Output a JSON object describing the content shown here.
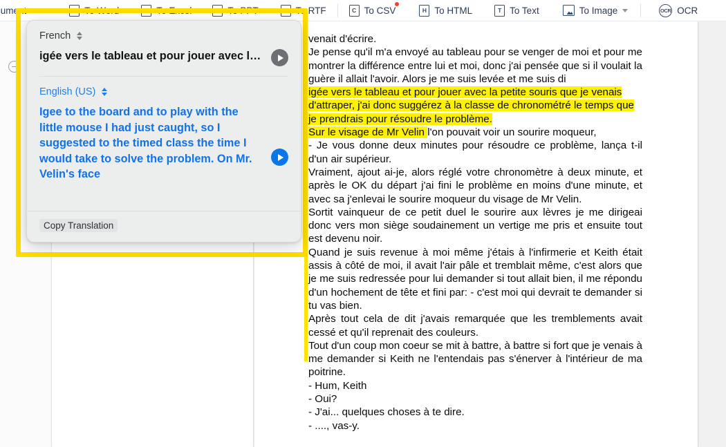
{
  "toolbar": {
    "items": [
      {
        "name": "document-dropdown",
        "label": "cument",
        "icon": "none",
        "caret": true,
        "badge": false
      },
      {
        "name": "to-word",
        "label": "To Word",
        "icon": "W",
        "caret": false,
        "badge": false
      },
      {
        "name": "to-excel",
        "label": "To Excel",
        "icon": "X",
        "caret": false,
        "badge": false
      },
      {
        "name": "to-ppt",
        "label": "To PPT",
        "icon": "P",
        "caret": false,
        "badge": false
      },
      {
        "name": "to-rtf",
        "label": "To RTF",
        "icon": "R",
        "caret": false,
        "badge": false
      },
      {
        "name": "to-csv",
        "label": "To CSV",
        "icon": "C",
        "caret": false,
        "badge": true
      },
      {
        "name": "to-html",
        "label": "To HTML",
        "icon": "H",
        "caret": false,
        "badge": false
      },
      {
        "name": "to-text",
        "label": "To Text",
        "icon": "T",
        "caret": false,
        "badge": false
      },
      {
        "name": "to-image",
        "label": "To Image",
        "icon": "image",
        "caret": true,
        "badge": false
      },
      {
        "name": "ocr",
        "label": "OCR",
        "icon": "ocr",
        "caret": false,
        "badge": false
      }
    ]
  },
  "translate_popup": {
    "source_language": "French",
    "source_text": "igée vers le tableau et pour jouer avec la...",
    "target_language": "English (US)",
    "target_text": "Igee to the board and to play with the little mouse I had just caught, so I suggested to the timed class the time I would take to solve the problem. On Mr. Velin's face",
    "copy_label": "Copy Translation",
    "source_play_icon": "play-icon",
    "target_play_icon": "play-icon",
    "language_stepper_icon": "chevron-updown-icon",
    "accent_color": "#1272ea",
    "panel_color": "#eceded"
  },
  "selection": {
    "highlight_color": "#ffdd00",
    "text_highlight_color": "#fff200"
  },
  "document": {
    "paragraphs": [
      {
        "id": "p1",
        "justify": false,
        "runs": [
          {
            "text": "venait d'écrire.",
            "hl": false
          }
        ]
      },
      {
        "id": "p2",
        "justify": true,
        "runs": [
          {
            "text": "Je pense qu'il m'a envoyé au tableau pour se venger de moi et pour me montrer la différence entre lui et moi, donc j'ai pensée que si il voulait la guère il allait l'avoir. Alors je me suis levée et me suis di",
            "hl": false
          }
        ]
      },
      {
        "id": "p3",
        "justify": false,
        "runs": [
          {
            "text": "   igée vers le tableau et pour jouer avec la petite souris que je venais d'attraper, j'ai donc suggérez à la classe de chronométré le temps que je prendrais pour résoudre le problème.",
            "hl": true
          }
        ]
      },
      {
        "id": "p4",
        "justify": false,
        "runs": [
          {
            "text": "Sur le visage de Mr Velin ",
            "hl": true
          },
          {
            "text": " l'on pouvait voir un sourire moqueur,",
            "hl": false
          }
        ]
      },
      {
        "id": "p5",
        "justify": true,
        "runs": [
          {
            "text": "- Je vous donne deux minutes pour résoudre ce problème, lança t-il d'un air supérieur.",
            "hl": false
          }
        ]
      },
      {
        "id": "p6",
        "justify": true,
        "runs": [
          {
            "text": "Vraiment, ajout ai-je, alors réglé votre chronomètre à deux minute, et après le OK du départ j'ai fini le problème en moins d'une minute, et avec sa j'enlevai le sourire moqueur du visage de Mr Velin.",
            "hl": false
          }
        ]
      },
      {
        "id": "p7",
        "justify": true,
        "runs": [
          {
            "text": "Sortit vainqueur de ce petit duel le sourire aux lèvres je me dirigeai donc vers mon siège soudainement un vertige me pris et ensuite tout est devenu noir.",
            "hl": false
          }
        ]
      },
      {
        "id": "p8",
        "justify": true,
        "runs": [
          {
            "text": "Quand je suis revenue à moi même j'étais à l'infirmerie et Keith était assis à côté de moi, il avait l'air pâle et tremblait même, c'est alors que je me suis redressée pour lui demander si tout allait bien, il me répondu d'un hochement de tête et fini par: - c'est moi qui devrait te demander si tu vas bien.",
            "hl": false
          }
        ]
      },
      {
        "id": "p9",
        "justify": true,
        "runs": [
          {
            "text": "Après tout cela de dit j'avais remarquée que les tremblements avait cessé et qu'il reprenait des couleurs.",
            "hl": false
          }
        ]
      },
      {
        "id": "p10",
        "justify": true,
        "runs": [
          {
            "text": "Tout d'un coup mon coeur se mit à battre, à battre si fort que je venais à me demander si Keith ne l'entendais pas s'énerver à l'intérieur de ma poitrine.",
            "hl": false
          }
        ]
      },
      {
        "id": "p11",
        "justify": false,
        "runs": [
          {
            "text": "- Hum, Keith",
            "hl": false
          }
        ]
      },
      {
        "id": "p12",
        "justify": false,
        "runs": [
          {
            "text": "- Oui?",
            "hl": false
          }
        ]
      },
      {
        "id": "p13",
        "justify": false,
        "runs": [
          {
            "text": "- J'ai... quelques choses à te dire.",
            "hl": false
          }
        ]
      },
      {
        "id": "p14",
        "justify": false,
        "runs": [
          {
            "text": "- ...., vas-y.",
            "hl": false
          }
        ]
      }
    ]
  },
  "viewer": {
    "zoom_out_icon": "minus-circle-icon"
  }
}
